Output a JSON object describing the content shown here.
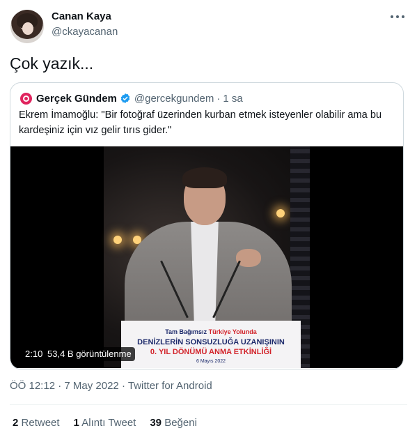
{
  "author": {
    "name": "Canan Kaya",
    "handle": "@ckayacanan"
  },
  "tweet": {
    "text": "Çok yazık..."
  },
  "quoted": {
    "name": "Gerçek Gündem",
    "handle": "@gercekgundem",
    "separator": "·",
    "time": "1 sa",
    "text": "Ekrem İmamoğlu: \"Bir fotoğraf üzerinden kurban etmek isteyenler olabilir ama bu kardeşiniz için vız gelir tırıs gider.\"",
    "video": {
      "duration": "2:10",
      "views": "53,4 B görüntülenme",
      "podium_line1_a": "Tam Bağımsız ",
      "podium_line1_b": "Türkiye Yolunda",
      "podium_line2": "DENİZLERİN SONSUZLUĞA UZANIŞININ",
      "podium_line3": "0. YIL DÖNÜMÜ ANMA ETKİNLİĞİ",
      "podium_line4": "6 Mayıs 2022"
    }
  },
  "meta": {
    "time": "ÖÖ 12:12",
    "date": "7 May 2022",
    "source": "Twitter for Android",
    "sep": "·"
  },
  "stats": {
    "retweets_count": "2",
    "retweets_label": "Retweet",
    "quotes_count": "1",
    "quotes_label": "Alıntı Tweet",
    "likes_count": "39",
    "likes_label": "Beğeni"
  },
  "colors": {
    "text": "#0f1419",
    "secondary": "#536471",
    "border": "#cfd9de",
    "verified": "#1d9bf0",
    "logo": "#e0245e"
  },
  "icons": [
    "more-icon",
    "verified-icon",
    "gercek-gundem-logo-icon"
  ]
}
